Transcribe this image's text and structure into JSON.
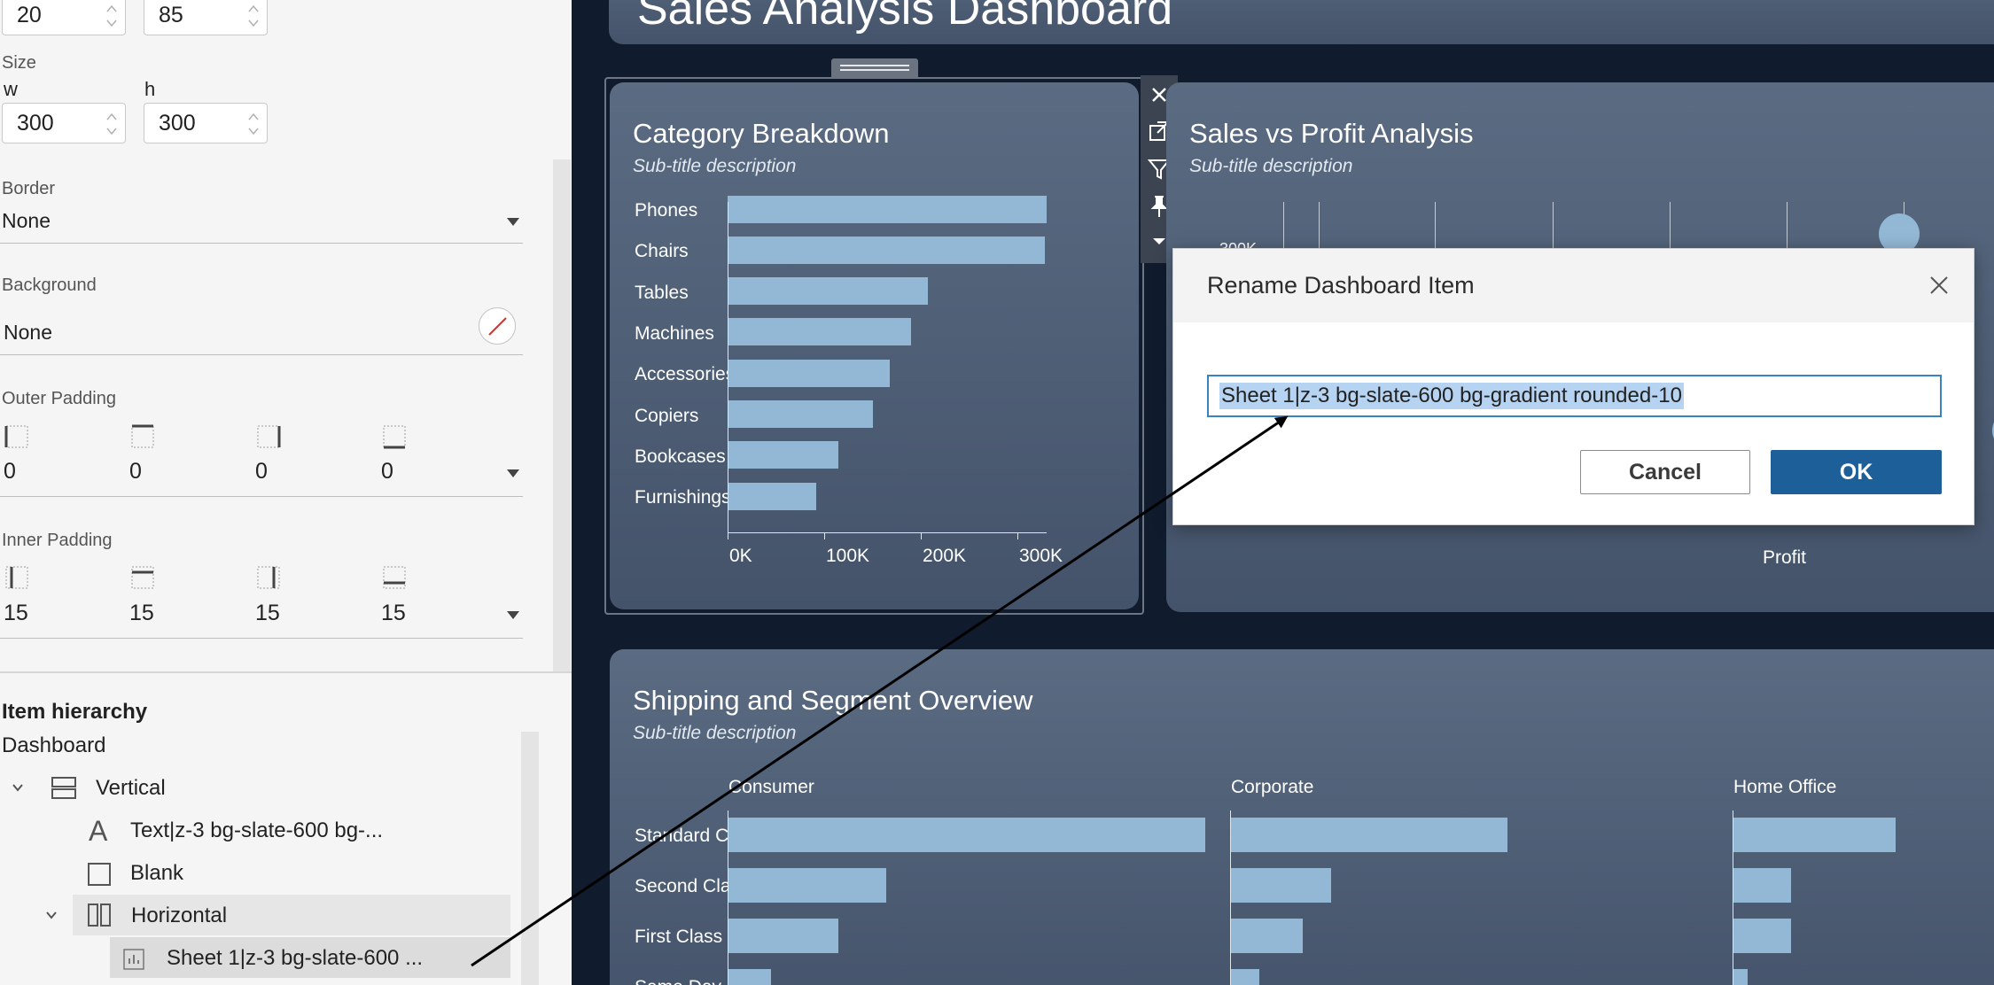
{
  "left_panel": {
    "position": {
      "x_value": "20",
      "y_value": "85"
    },
    "size": {
      "section_label": "Size",
      "w_label": "w",
      "h_label": "h",
      "w_value": "300",
      "h_value": "300"
    },
    "border": {
      "label": "Border",
      "value": "None"
    },
    "background": {
      "label": "Background",
      "value": "None"
    },
    "outer_padding": {
      "label": "Outer Padding",
      "values": [
        "0",
        "0",
        "0",
        "0"
      ]
    },
    "inner_padding": {
      "label": "Inner Padding",
      "values": [
        "15",
        "15",
        "15",
        "15"
      ]
    },
    "hierarchy": {
      "title": "Item hierarchy",
      "root": "Dashboard",
      "items": [
        {
          "label": "Vertical",
          "icon": "vertical-container-icon"
        },
        {
          "label": "Text|z-3 bg-slate-600 bg-...",
          "icon": "text-icon"
        },
        {
          "label": "Blank",
          "icon": "blank-icon"
        },
        {
          "label": "Horizontal",
          "icon": "horizontal-container-icon"
        },
        {
          "label": "Sheet 1|z-3 bg-slate-600 ...",
          "icon": "sheet-chart-icon"
        }
      ]
    }
  },
  "dashboard": {
    "title": "Sales Analysis Dashboard",
    "colors": {
      "background": "#101b2e",
      "card": "#52627a",
      "bar": "#93b8d5",
      "accent": "#1d5f99"
    },
    "category_card": {
      "title": "Category Breakdown",
      "subtitle": "Sub-title description",
      "chart_data": {
        "type": "bar",
        "orientation": "horizontal",
        "categories": [
          "Phones",
          "Chairs",
          "Tables",
          "Machines",
          "Accessories",
          "Copiers",
          "Bookcases",
          "Furnishings"
        ],
        "values": [
          330000,
          328000,
          207000,
          190000,
          168000,
          150000,
          115000,
          92000
        ],
        "xticks": [
          "0K",
          "100K",
          "200K",
          "300K"
        ],
        "xlim": [
          0,
          350000
        ]
      }
    },
    "sales_profit_card": {
      "title": "Sales vs Profit Analysis",
      "subtitle": "Sub-title description",
      "xlabel": "Profit",
      "ytick": "300K"
    },
    "shipping_card": {
      "title": "Shipping and Segment Overview",
      "subtitle": "Sub-title description",
      "chart_data": {
        "type": "bar",
        "orientation": "horizontal",
        "segments": [
          "Consumer",
          "Corporate",
          "Home Office"
        ],
        "categories": [
          "Standard Class",
          "Second Class",
          "First Class",
          "Same Day"
        ],
        "series": [
          {
            "name": "Consumer",
            "values": [
              1.0,
              0.33,
              0.23,
              0.09
            ]
          },
          {
            "name": "Corporate",
            "values": [
              0.58,
              0.21,
              0.15,
              0.06
            ]
          },
          {
            "name": "Home Office",
            "values": [
              0.34,
              0.12,
              0.12,
              0.03
            ]
          }
        ]
      }
    },
    "toolbar": {
      "icons": [
        "close-icon",
        "open-external-icon",
        "filter-icon",
        "pin-icon",
        "more-options-icon"
      ]
    }
  },
  "dialog": {
    "title": "Rename Dashboard Item",
    "input_value": "Sheet 1|z-3 bg-slate-600 bg-gradient rounded-10",
    "cancel_label": "Cancel",
    "ok_label": "OK"
  }
}
